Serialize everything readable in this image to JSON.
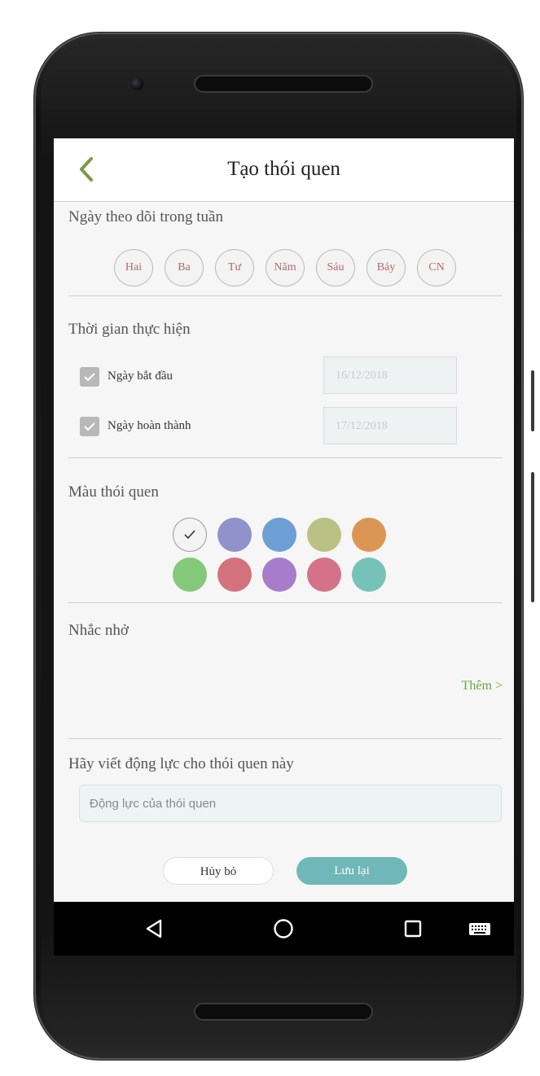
{
  "header": {
    "title": "Tạo thói quen",
    "back_icon": "chevron-left-icon"
  },
  "weekdays": {
    "label": "Ngày theo dõi trong tuần",
    "days": [
      "Hai",
      "Ba",
      "Tư",
      "Năm",
      "Sáu",
      "Bảy",
      "CN"
    ]
  },
  "time": {
    "label": "Thời gian thực hiện",
    "start": {
      "label": "Ngày bắt đầu",
      "value": "16/12/2018",
      "checked": true
    },
    "end": {
      "label": "Ngày hoàn thành",
      "value": "17/12/2018",
      "checked": true
    }
  },
  "colors": {
    "label": "Màu thói quen",
    "selected_index": 0,
    "palette": [
      "#f3f3f3",
      "#9191cc",
      "#6d9ed4",
      "#b9c283",
      "#db9656",
      "#84c97a",
      "#d4727b",
      "#a77ccb",
      "#d4728a",
      "#76c2b8"
    ]
  },
  "reminder": {
    "label": "Nhắc nhở",
    "more_label": "Thêm >"
  },
  "motivation": {
    "label": "Hãy viết động lực cho thói quen này",
    "placeholder": "Động lực của thói quen"
  },
  "actions": {
    "cancel_label": "Hủy bỏ",
    "save_label": "Lưu lại"
  },
  "navbar": [
    "back-triangle-icon",
    "home-circle-icon",
    "recents-square-icon",
    "keyboard-icon"
  ]
}
